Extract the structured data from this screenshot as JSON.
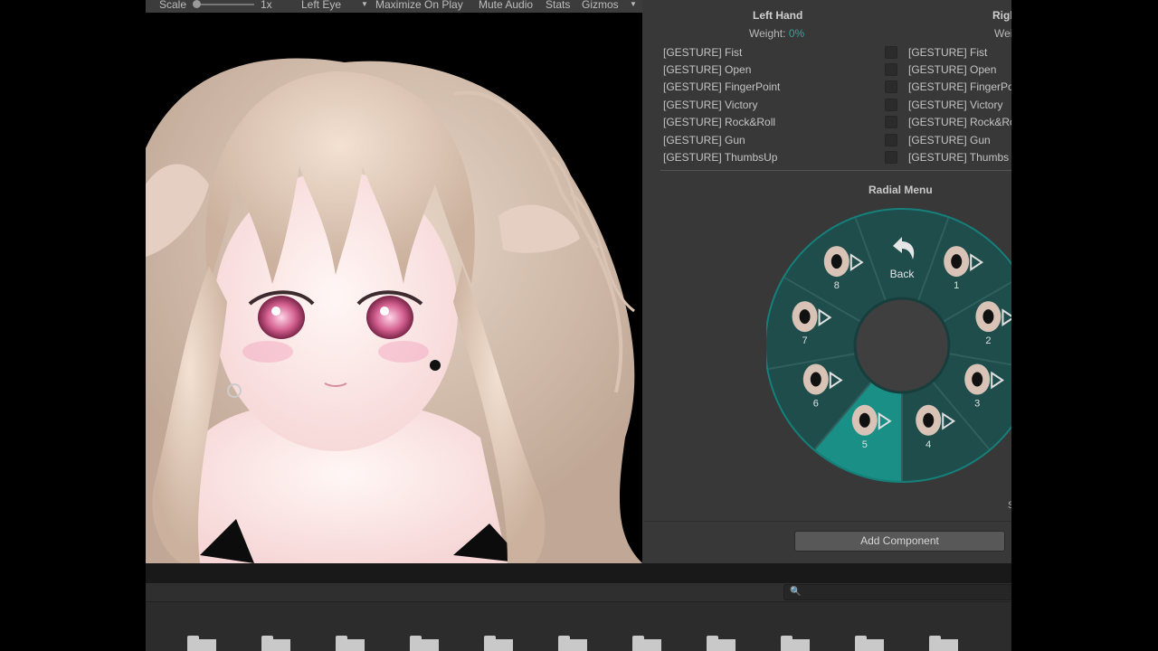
{
  "toolbar": {
    "scale_label": "Scale",
    "scale_value": "1x",
    "eye_option": "Left Eye",
    "maximize_on_play": "Maximize On Play",
    "mute_audio": "Mute Audio",
    "stats": "Stats",
    "gizmos": "Gizmos"
  },
  "gesture_manager": {
    "left": {
      "title": "Left Hand",
      "weight_label": "Weight:",
      "weight_value": "0%",
      "gestures": [
        "[GESTURE] Fist",
        "[GESTURE] Open",
        "[GESTURE] FingerPoint",
        "[GESTURE] Victory",
        "[GESTURE] Rock&Roll",
        "[GESTURE] Gun",
        "[GESTURE] ThumbsUp"
      ]
    },
    "right": {
      "title": "Righ",
      "weight_label": "Wei",
      "gestures": [
        "[GESTURE] Fist",
        "[GESTURE] Open",
        "[GESTURE] FingerPo",
        "[GESTURE] Victory",
        "[GESTURE] Rock&Ro",
        "[GESTURE] Gun",
        "[GESTURE] Thumbs"
      ]
    }
  },
  "radial_menu": {
    "title": "Radial Menu",
    "back_label": "Back",
    "slot_labels": [
      "1",
      "2",
      "3",
      "4",
      "5",
      "6",
      "7",
      "8"
    ],
    "selected_slot": "5",
    "accent_color": "#1a8f86",
    "ring_color": "#1e4d4b"
  },
  "side_char": "S",
  "add_component_label": "Add Component",
  "search": {
    "icon": "search-icon"
  },
  "colors": {
    "panel": "#383838",
    "weight_value": "#2ea59a"
  }
}
